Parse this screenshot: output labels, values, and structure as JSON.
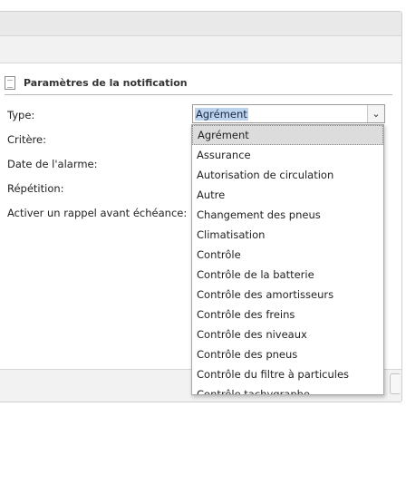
{
  "section": {
    "title": "Paramètres de la notification"
  },
  "labels": {
    "type": "Type:",
    "critere": "Critère:",
    "date_alarme": "Date de l'alarme:",
    "repetition": "Répétition:",
    "rappel": "Activer un rappel avant échéance:"
  },
  "type_select": {
    "value": "Agrément",
    "arrow": "⌄"
  },
  "dropdown": {
    "options": [
      "Agrément",
      "Assurance",
      "Autorisation de circulation",
      "Autre",
      "Changement des pneus",
      "Climatisation",
      "Contrôle",
      "Contrôle de la batterie",
      "Contrôle des amortisseurs",
      "Contrôle des freins",
      "Contrôle des niveaux",
      "Contrôle des pneus",
      "Contrôle du filtre à particules",
      "Contrôle tachygraphe"
    ]
  }
}
